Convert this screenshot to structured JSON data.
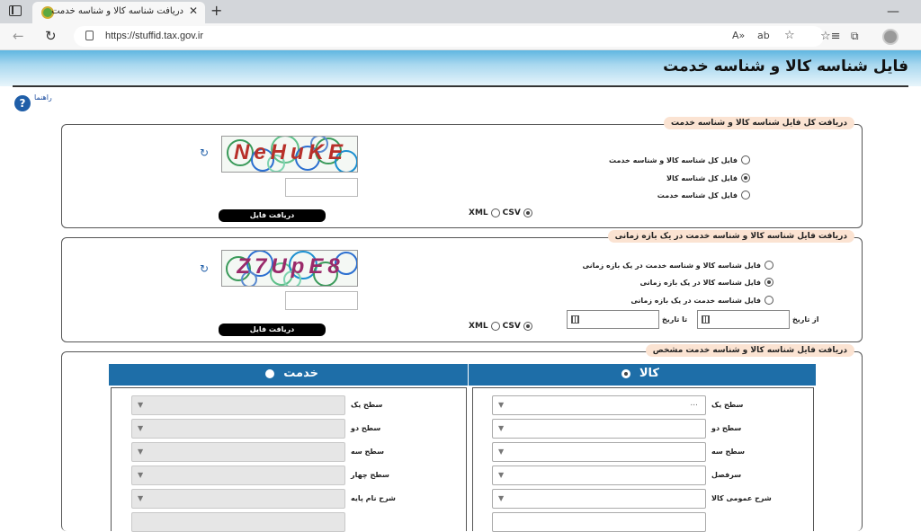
{
  "browser": {
    "tab_title": "دریافت شناسه کالا و شناسه خدمت",
    "url": "https://stuffid.tax.gov.ir"
  },
  "page": {
    "title": "فایل شناسه کالا و شناسه خدمت",
    "help_label": "راهنما"
  },
  "section1": {
    "legend": "دریافت کل فایل شناسه کالا و شناسه خدمت",
    "options": [
      {
        "label": "فایل کل شناسه کالا و شناسه خدمت",
        "selected": false
      },
      {
        "label": "فایل کل شناسه کالا",
        "selected": true
      },
      {
        "label": "فایل کل شناسه خدمت",
        "selected": false
      }
    ],
    "captcha_text": "NeHuKE",
    "download_label": "دریافت فایل",
    "format_xml": "XML",
    "format_csv": "CSV",
    "selected_format": "CSV"
  },
  "section2": {
    "legend": "دریافت فایل شناسه کالا و شناسه خدمت در یک بازه زمانی",
    "options": [
      {
        "label": "فایل شناسه کالا و شناسه خدمت در یک بازه زمانی",
        "selected": false
      },
      {
        "label": "فایل شناسه کالا در یک بازه زمانی",
        "selected": true
      },
      {
        "label": "فایل شناسه خدمت در یک بازه زمانی",
        "selected": false
      }
    ],
    "from_date_label": "از تاریخ",
    "to_date_label": "تا تاریخ",
    "captcha_text": "Z7UpE8",
    "download_label": "دریافت فایل",
    "format_xml": "XML",
    "format_csv": "CSV",
    "selected_format": "CSV"
  },
  "section3": {
    "legend": "دریافت فایل شناسه کالا و شناسه خدمت مشخص",
    "goods": {
      "header": "کالا",
      "selected": true,
      "fields": [
        {
          "label": "سطح یک",
          "placeholder": "...",
          "disabled": false
        },
        {
          "label": "سطح دو",
          "placeholder": "",
          "disabled": false
        },
        {
          "label": "سطح سه",
          "placeholder": "",
          "disabled": false
        },
        {
          "label": "سرفصل",
          "placeholder": "",
          "disabled": false
        },
        {
          "label": "شرح عمومی کالا",
          "placeholder": "",
          "disabled": false
        }
      ]
    },
    "service": {
      "header": "خدمت",
      "selected": false,
      "fields": [
        {
          "label": "سطح یک",
          "placeholder": "",
          "disabled": true
        },
        {
          "label": "سطح دو",
          "placeholder": "",
          "disabled": true
        },
        {
          "label": "سطح سه",
          "placeholder": "",
          "disabled": true
        },
        {
          "label": "سطح چهار",
          "placeholder": "",
          "disabled": true
        },
        {
          "label": "شرح نام پایه",
          "placeholder": "",
          "disabled": true
        }
      ]
    }
  },
  "colors": {
    "banner": "#5fb6e1",
    "legend_bg": "#fbe3d2",
    "column_header": "#1e6ea8"
  }
}
